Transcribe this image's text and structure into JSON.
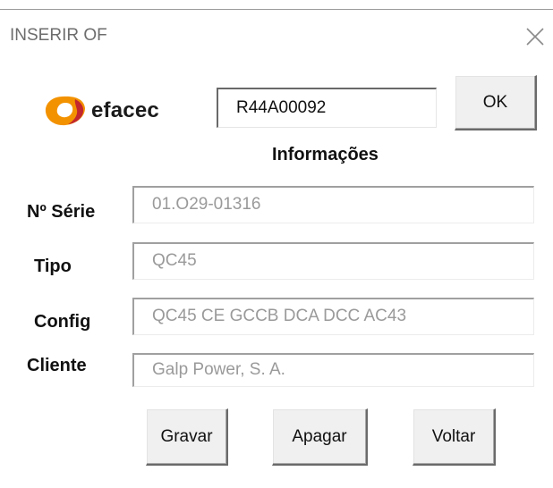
{
  "window": {
    "title": "INSERIR OF"
  },
  "logo": {
    "text": "efacec",
    "icon": "efacec-logo-icon",
    "colors": [
      "#f39200",
      "#c2262e"
    ]
  },
  "of_input": {
    "value": "R44A00092"
  },
  "buttons": {
    "ok": "OK",
    "gravar": "Gravar",
    "apagar": "Apagar",
    "voltar": "Voltar"
  },
  "section": {
    "heading": "Informações"
  },
  "fields": {
    "serie": {
      "label": "Nº Série",
      "value": "01.O29-01316"
    },
    "tipo": {
      "label": "Tipo",
      "value": "QC45"
    },
    "config": {
      "label": "Config",
      "value": "QC45 CE GCCB DCA DCC AC43"
    },
    "cliente": {
      "label": "Cliente",
      "value": "Galp Power, S. A."
    }
  }
}
